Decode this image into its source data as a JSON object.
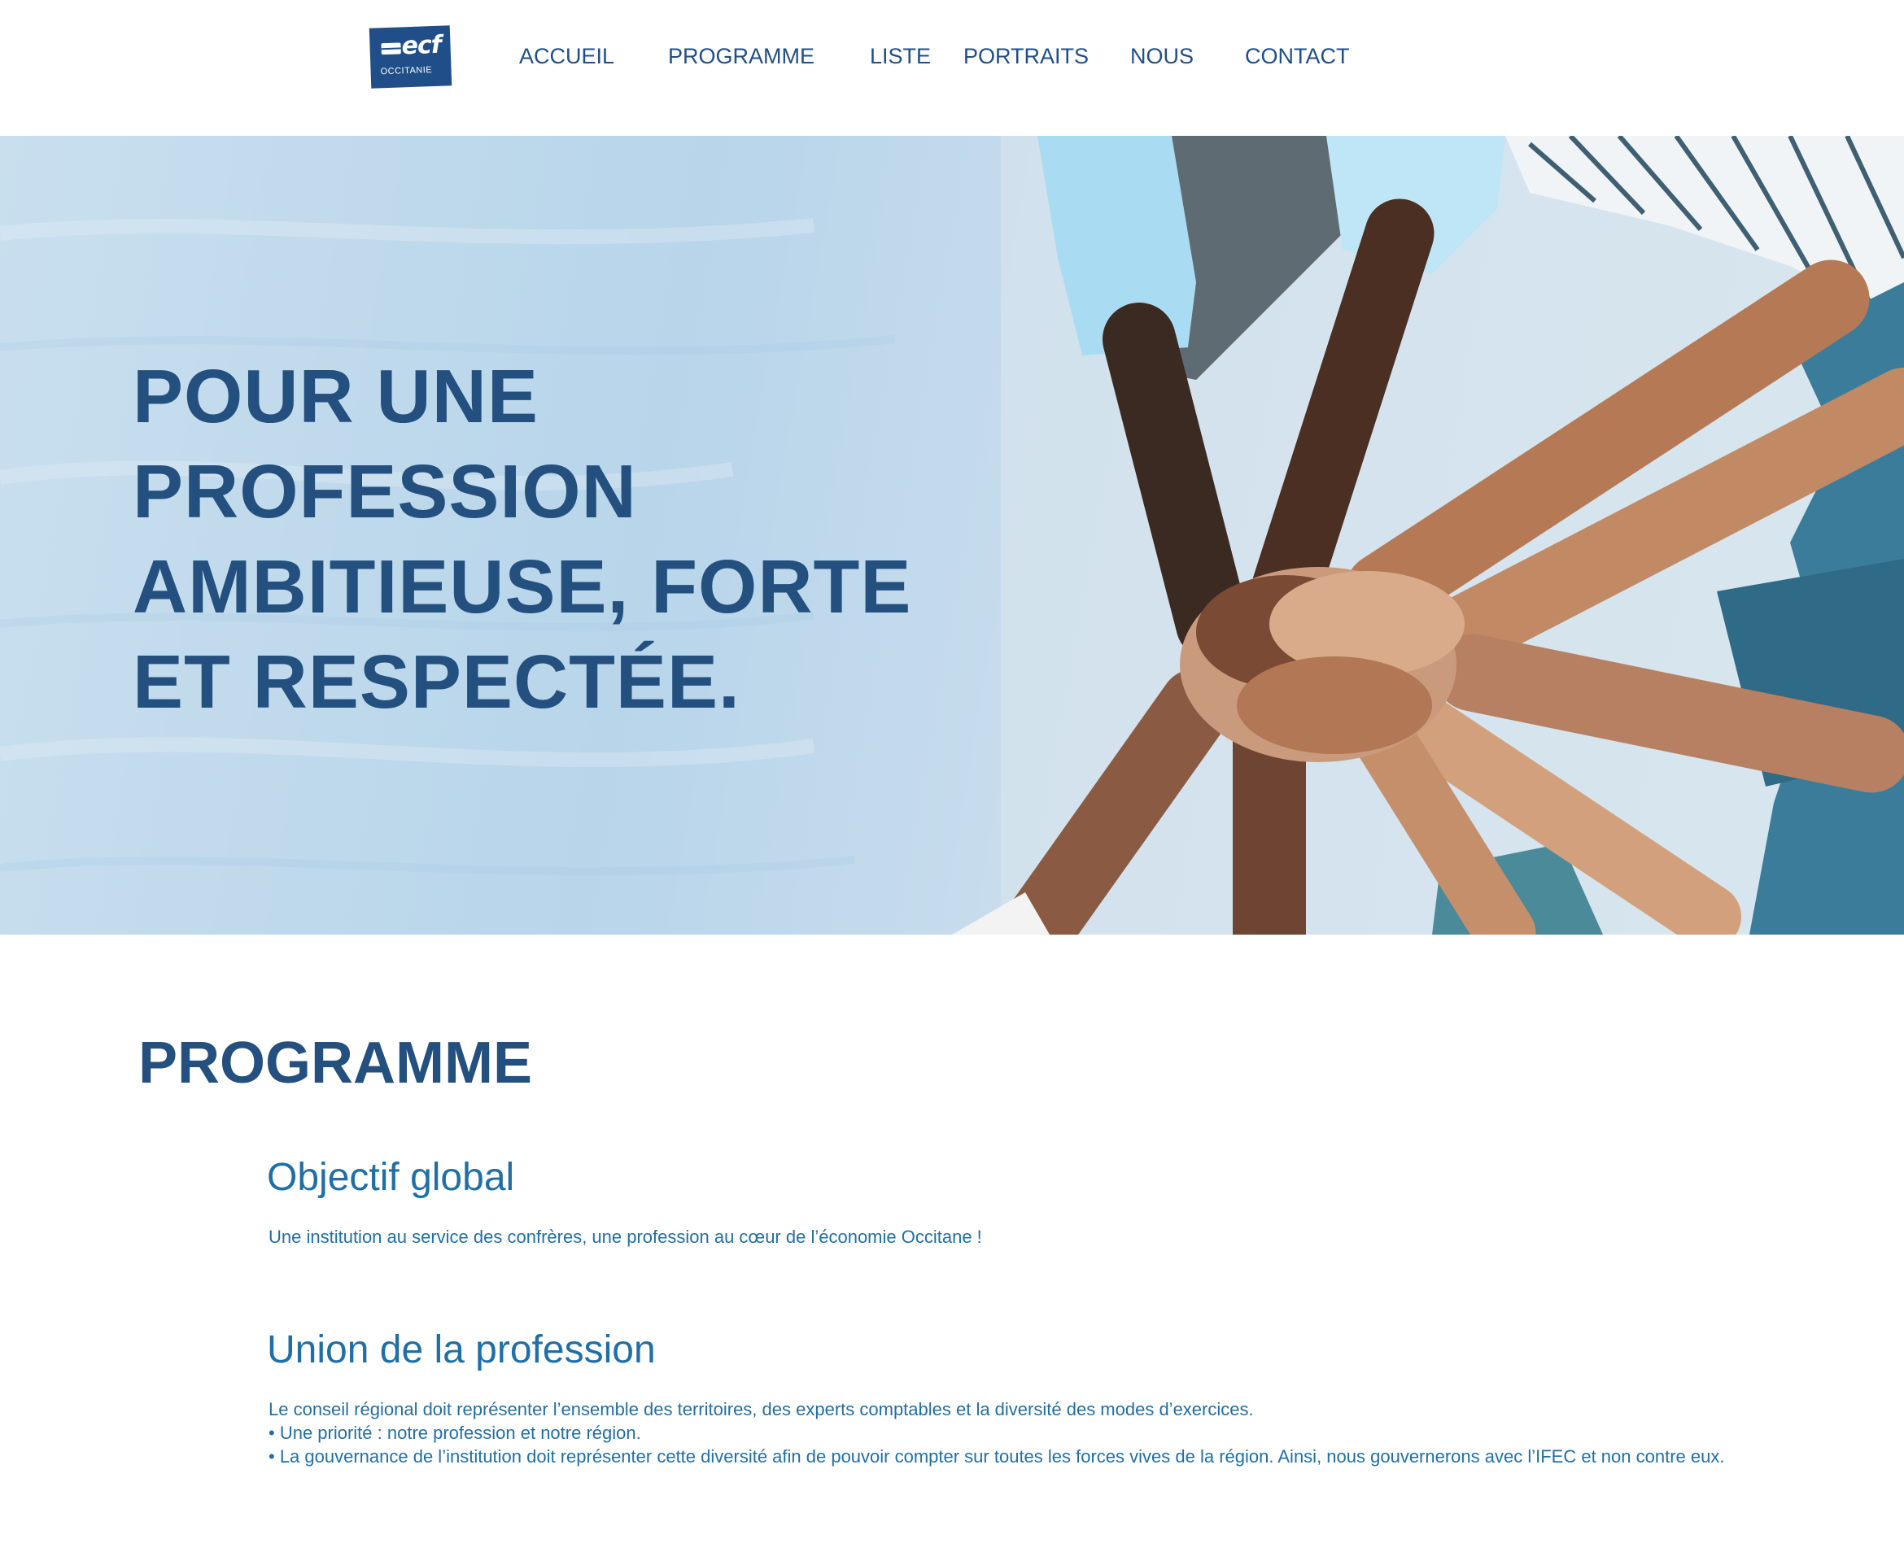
{
  "header": {
    "logo": {
      "brand": "ecf",
      "region": "OCCITANIE"
    },
    "nav": [
      {
        "label": "ACCUEIL"
      },
      {
        "label": "PROGRAMME"
      },
      {
        "label": "LISTE"
      },
      {
        "label": "PORTRAITS"
      },
      {
        "label": "NOUS"
      },
      {
        "label": "CONTACT"
      }
    ]
  },
  "hero": {
    "title": "POUR UNE PROFESSION AMBITIEUSE, FORTE ET RESPECTÉE."
  },
  "programme": {
    "title": "PROGRAMME",
    "blocks": [
      {
        "heading": "Objectif global",
        "lines": [
          "Une institution au service des confrères, une profession au cœur de l’économie Occitane !"
        ]
      },
      {
        "heading": "Union de la profession",
        "lines": [
          "Le conseil régional doit représenter l’ensemble des territoires, des experts comptables et la diversité des modes d’exercices.",
          "• Une priorité : notre profession et notre région.",
          "• La gouvernance de l’institution doit représenter cette diversité afin de pouvoir compter sur toutes les forces vives de la région. Ainsi, nous gouvernerons avec l’IFEC et non contre eux."
        ]
      }
    ]
  },
  "colors": {
    "brand_blue": "#1f4e88",
    "heading_blue": "#24507f",
    "text_blue": "#1f6fa6",
    "hero_background": "#c6dcec"
  }
}
